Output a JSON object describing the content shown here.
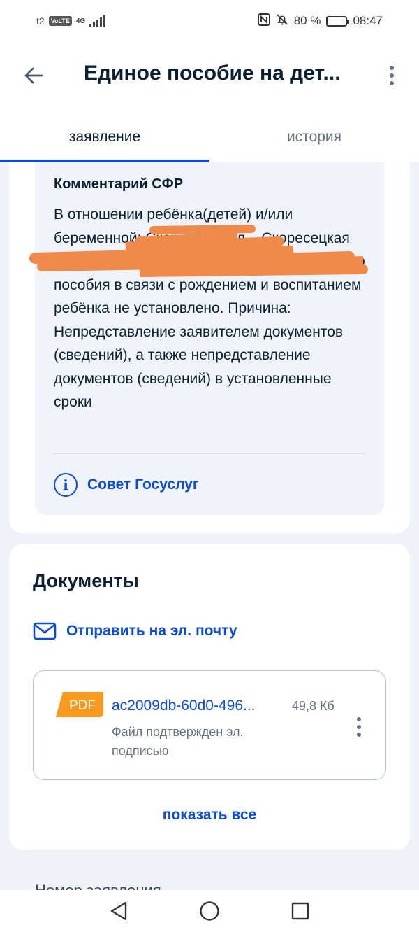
{
  "status_bar": {
    "carrier": "t2",
    "volte": "VoLTE",
    "network": "4G",
    "battery_percent": "80 %",
    "battery_level": 0.8,
    "time": "08:47"
  },
  "header": {
    "title": "Единое пособие на дет..."
  },
  "tabs": [
    {
      "label": "заявление",
      "active": true
    },
    {
      "label": "история",
      "active": false
    }
  ],
  "comment": {
    "title": "Комментарий СФР",
    "text": "В отношении ребёнка(детей) и/или беременной: Скоре... Никол... Скоресецкая Никол... ... право на получение ежемесячного пособия в связи с рождением и воспитанием ребёнка не установлено. Причина: Непредставление заявителем документов (сведений), а также непредставление документов (сведений) в установленные сроки",
    "tip_label": "Совет Госуслуг"
  },
  "documents": {
    "title": "Документы",
    "email_link": "Отправить на эл. почту",
    "file": {
      "badge": "PDF",
      "name": "ac2009db-60d0-496...",
      "size": "49,8 Кб",
      "status": "Файл подтвержден эл. подписью"
    },
    "show_all": "показать все"
  },
  "next_section": {
    "heading": "Номер заявления"
  },
  "colors": {
    "accent": "#0d4cd3",
    "text": "#0b1f33",
    "muted": "#66727f",
    "pdf_orange": "#f79a1e",
    "redaction": "#f08a4b"
  }
}
